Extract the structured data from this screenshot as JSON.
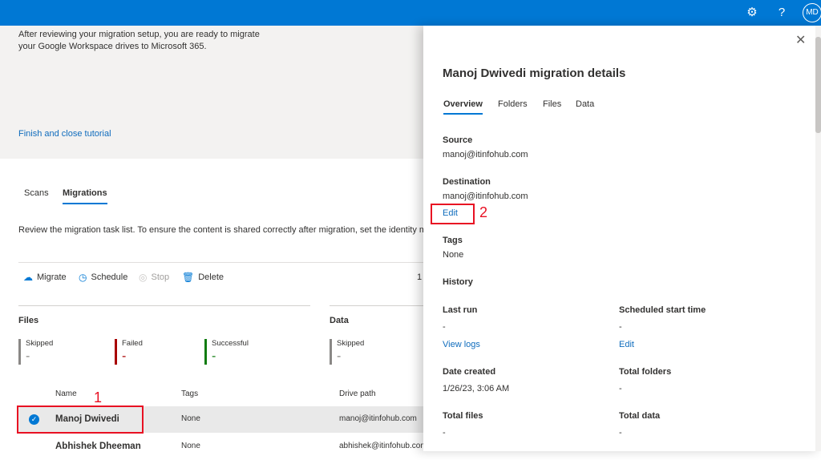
{
  "topbar": {
    "settings_icon": "gear-icon",
    "help": "?",
    "avatar": "MD"
  },
  "hero": {
    "line1": "After reviewing your migration setup, you are ready to migrate",
    "line2": "your Google Workspace drives to Microsoft 365.",
    "finish_link": "Finish and close tutorial"
  },
  "tabs": [
    {
      "label": "Scans"
    },
    {
      "label": "Migrations"
    }
  ],
  "description": "Review the migration task list. To ensure the content is shared correctly after migration, set the identity m",
  "toolbar": {
    "migrate": "Migrate",
    "schedule": "Schedule",
    "stop": "Stop",
    "delete": "Delete",
    "count": "1"
  },
  "files": {
    "title": "Files",
    "skipped_label": "Skipped",
    "skipped": "-",
    "failed_label": "Failed",
    "failed": "-",
    "successful_label": "Successful",
    "successful": "-"
  },
  "data_section": {
    "title": "Data",
    "skipped_label": "Skipped",
    "skipped": "-"
  },
  "table": {
    "headers": [
      "Name",
      "Tags",
      "Drive path"
    ],
    "rows": [
      {
        "name": "Manoj Dwivedi",
        "tags": "None",
        "path": "manoj@itinfohub.com",
        "selected": true
      },
      {
        "name": "Abhishek Dheeman",
        "tags": "None",
        "path": "abhishek@itinfohub.com",
        "selected": false
      }
    ]
  },
  "annotations": {
    "one": "1",
    "two": "2"
  },
  "panel": {
    "title": "Manoj Dwivedi migration details",
    "tabs": [
      "Overview",
      "Folders",
      "Files",
      "Data"
    ],
    "source_label": "Source",
    "source": "manoj@itinfohub.com",
    "destination_label": "Destination",
    "destination": "manoj@itinfohub.com",
    "edit": "Edit",
    "tags_label": "Tags",
    "tags": "None",
    "history_label": "History",
    "last_run_label": "Last run",
    "last_run": "-",
    "view_logs": "View logs",
    "scheduled_label": "Scheduled start time",
    "scheduled": "-",
    "scheduled_edit": "Edit",
    "date_created_label": "Date created",
    "date_created": "1/26/23, 3:06 AM",
    "total_folders_label": "Total folders",
    "total_folders": "-",
    "total_files_label": "Total files",
    "total_files": "-",
    "total_data_label": "Total data",
    "total_data": "-"
  },
  "colors": {
    "brand": "#0078d4",
    "failed": "#a80000",
    "success": "#107c10",
    "annotation": "#e81123"
  }
}
